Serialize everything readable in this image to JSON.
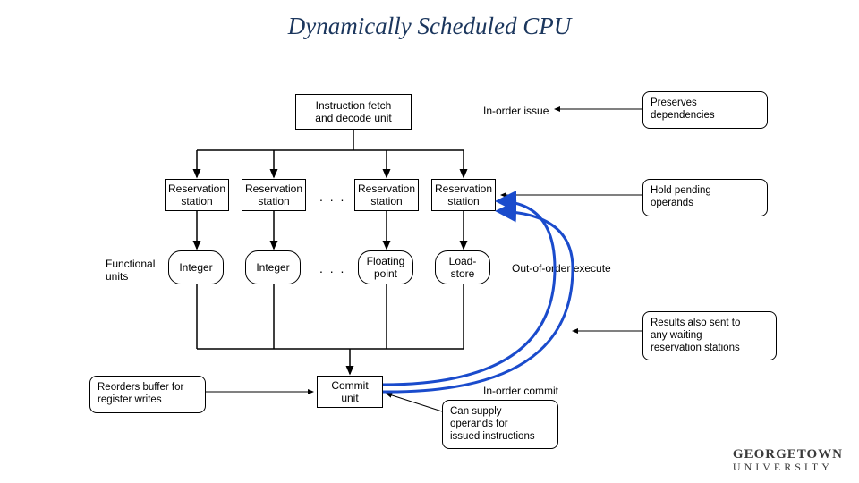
{
  "title": "Dynamically Scheduled CPU",
  "fetch_decode": "Instruction fetch\nand decode unit",
  "in_order_issue": "In-order issue",
  "reservation_stations": [
    "Reservation\nstation",
    "Reservation\nstation",
    "Reservation\nstation",
    "Reservation\nstation"
  ],
  "functional_units_label": "Functional\nunits",
  "functional_units": [
    "Integer",
    "Integer",
    "Floating\npoint",
    "Load-\nstore"
  ],
  "out_of_order_execute": "Out-of-order execute",
  "commit_unit": "Commit\nunit",
  "in_order_commit": "In-order commit",
  "notes": {
    "preserves": "Preserves\ndependencies",
    "hold": "Hold pending\noperands",
    "results": "Results also sent to\nany waiting\nreservation stations",
    "reorders": "Reorders buffer for\nregister writes",
    "supply": "Can supply\noperands for\nissued instructions"
  },
  "brand": {
    "line1": "GEORGETOWN",
    "line2": "UNIVERSITY"
  },
  "ellipsis": ". . ."
}
